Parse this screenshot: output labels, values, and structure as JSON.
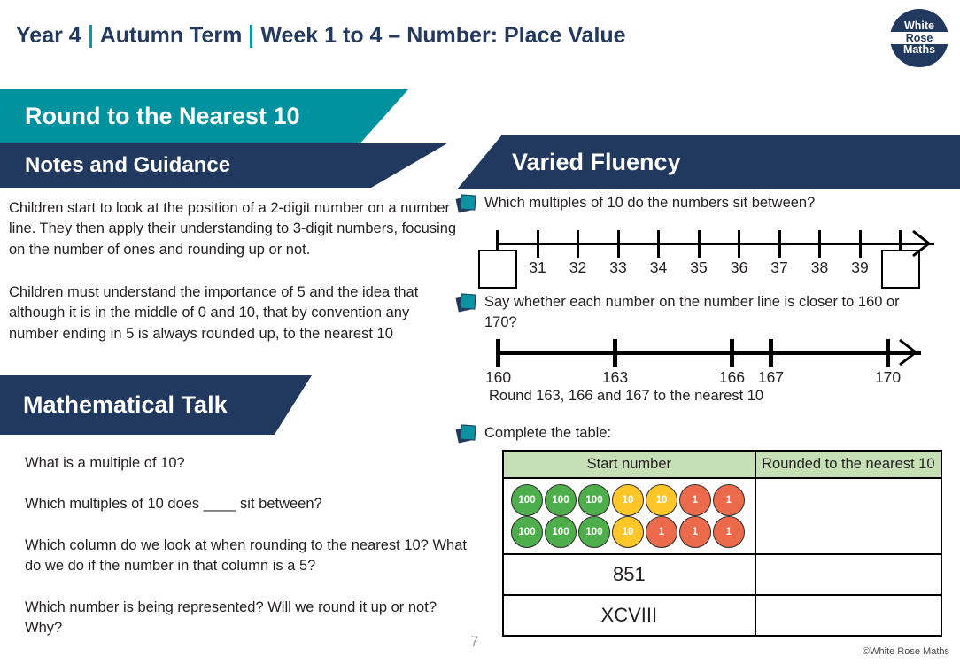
{
  "header": {
    "year": "Year 4",
    "term": "Autumn Term",
    "week_topic": "Week 1 to 4 – Number: Place Value",
    "logo": {
      "line1": "White",
      "line2": "Rose",
      "line3": "Maths"
    }
  },
  "lesson": {
    "title": "Round to the Nearest 10",
    "notes_heading": "Notes and Guidance",
    "notes": [
      "Children start to look at the position of a 2-digit number on a number line. They then apply their understanding to 3-digit numbers, focusing on the number of ones and rounding up or not.",
      "Children must understand the importance of 5 and the idea that although it is in the middle of 0 and 10, that by convention any number ending in 5 is always rounded up, to the nearest 10"
    ],
    "talk_heading": "Mathematical Talk",
    "talk_questions": [
      "What is a multiple of 10?",
      "Which multiples of 10 does ____ sit between?",
      "Which column do we look at when rounding to the nearest 10? What do we do if the number in that column is a 5?",
      "Which number is being represented? Will we round it up or not? Why?"
    ]
  },
  "varied_fluency": {
    "heading": "Varied Fluency",
    "task1": "Which multiples of 10 do the numbers sit between?",
    "task2": "Say whether each number on the number line is closer to 160 or 170?",
    "task2_caption": "Round 163, 166 and 167 to the nearest 10",
    "task3": "Complete the table:"
  },
  "number_line_1": {
    "tick_labels": [
      "",
      "31",
      "32",
      "33",
      "34",
      "35",
      "36",
      "37",
      "38",
      "39",
      ""
    ],
    "answer_box_positions": [
      0,
      10
    ]
  },
  "number_line_2": {
    "min": 160,
    "max": 170,
    "ticks": [
      160,
      163,
      166,
      167,
      170
    ],
    "tick_labels": [
      "160",
      "163",
      "166",
      "167",
      "170"
    ]
  },
  "table": {
    "headers": [
      "Start number",
      "Rounded to the nearest 10"
    ],
    "rows": [
      {
        "type": "counters",
        "counter_rows": [
          [
            "100",
            "100",
            "100",
            "10",
            "10",
            "1",
            "1"
          ],
          [
            "100",
            "100",
            "100",
            "10",
            "1",
            "1",
            "1"
          ]
        ],
        "answer": ""
      },
      {
        "type": "text",
        "value": "851",
        "answer": ""
      },
      {
        "type": "text",
        "value": "XCVIII",
        "answer": ""
      }
    ]
  },
  "footer": {
    "page_number": "7",
    "copyright": "©White Rose Maths"
  },
  "colors": {
    "teal": "#00939f",
    "navy": "#21395e",
    "table_header_green": "#c6dfb4",
    "counter_hundred": "#4fae4c",
    "counter_ten": "#ffc629",
    "counter_one": "#ec6a4c"
  }
}
